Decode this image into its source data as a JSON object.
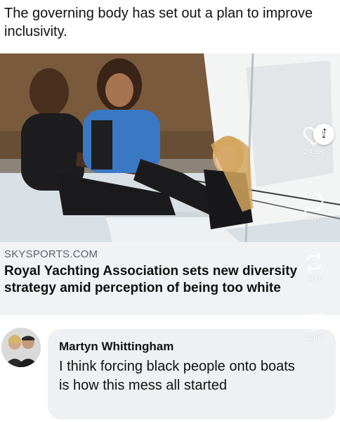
{
  "post": {
    "text": "The governing body has set out a plan to improve inclusivity."
  },
  "link": {
    "domain": "SKYSPORTS.COM",
    "title": "Royal Yachting Association sets new diversity strategy amid perception of being too white",
    "image_description": "Sailing photo"
  },
  "comment": {
    "author": "Martyn Whittingham",
    "text": "I think forcing black people onto boats is how this mess all started"
  },
  "side_actions": {
    "like_count": "24.9K",
    "comment_count": "387",
    "share_count": "400",
    "send_count": "126K"
  },
  "colors": {
    "page_bg": "#ffffff",
    "card_bg": "#f0f2f5",
    "bubble_bg": "#eef0f3",
    "domain_text": "#5f6368",
    "life_vest_blue": "#3b78c4"
  }
}
